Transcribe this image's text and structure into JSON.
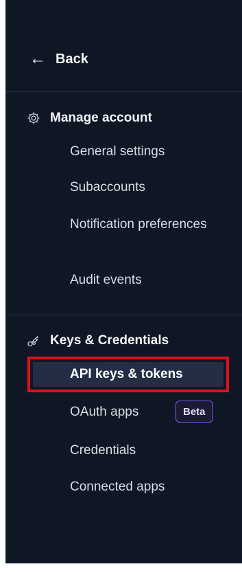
{
  "back": {
    "label": "Back",
    "icon": "arrow-left-icon"
  },
  "sections": [
    {
      "title": "Manage account",
      "icon": "gear-icon",
      "items": [
        {
          "label": "General settings"
        },
        {
          "label": "Subaccounts"
        },
        {
          "label": "Notification preferences"
        },
        {
          "label": "Audit events"
        }
      ]
    },
    {
      "title": "Keys & Credentials",
      "icon": "keys-icon",
      "items": [
        {
          "label": "API keys & tokens",
          "active": true
        },
        {
          "label": "OAuth apps",
          "badge": "Beta"
        },
        {
          "label": "Credentials"
        },
        {
          "label": "Connected apps"
        }
      ]
    }
  ],
  "colors": {
    "sidebar_bg": "#0f1624",
    "active_bg": "#232e44",
    "highlight_border": "#e0101a",
    "badge_border": "#7b5cff"
  }
}
